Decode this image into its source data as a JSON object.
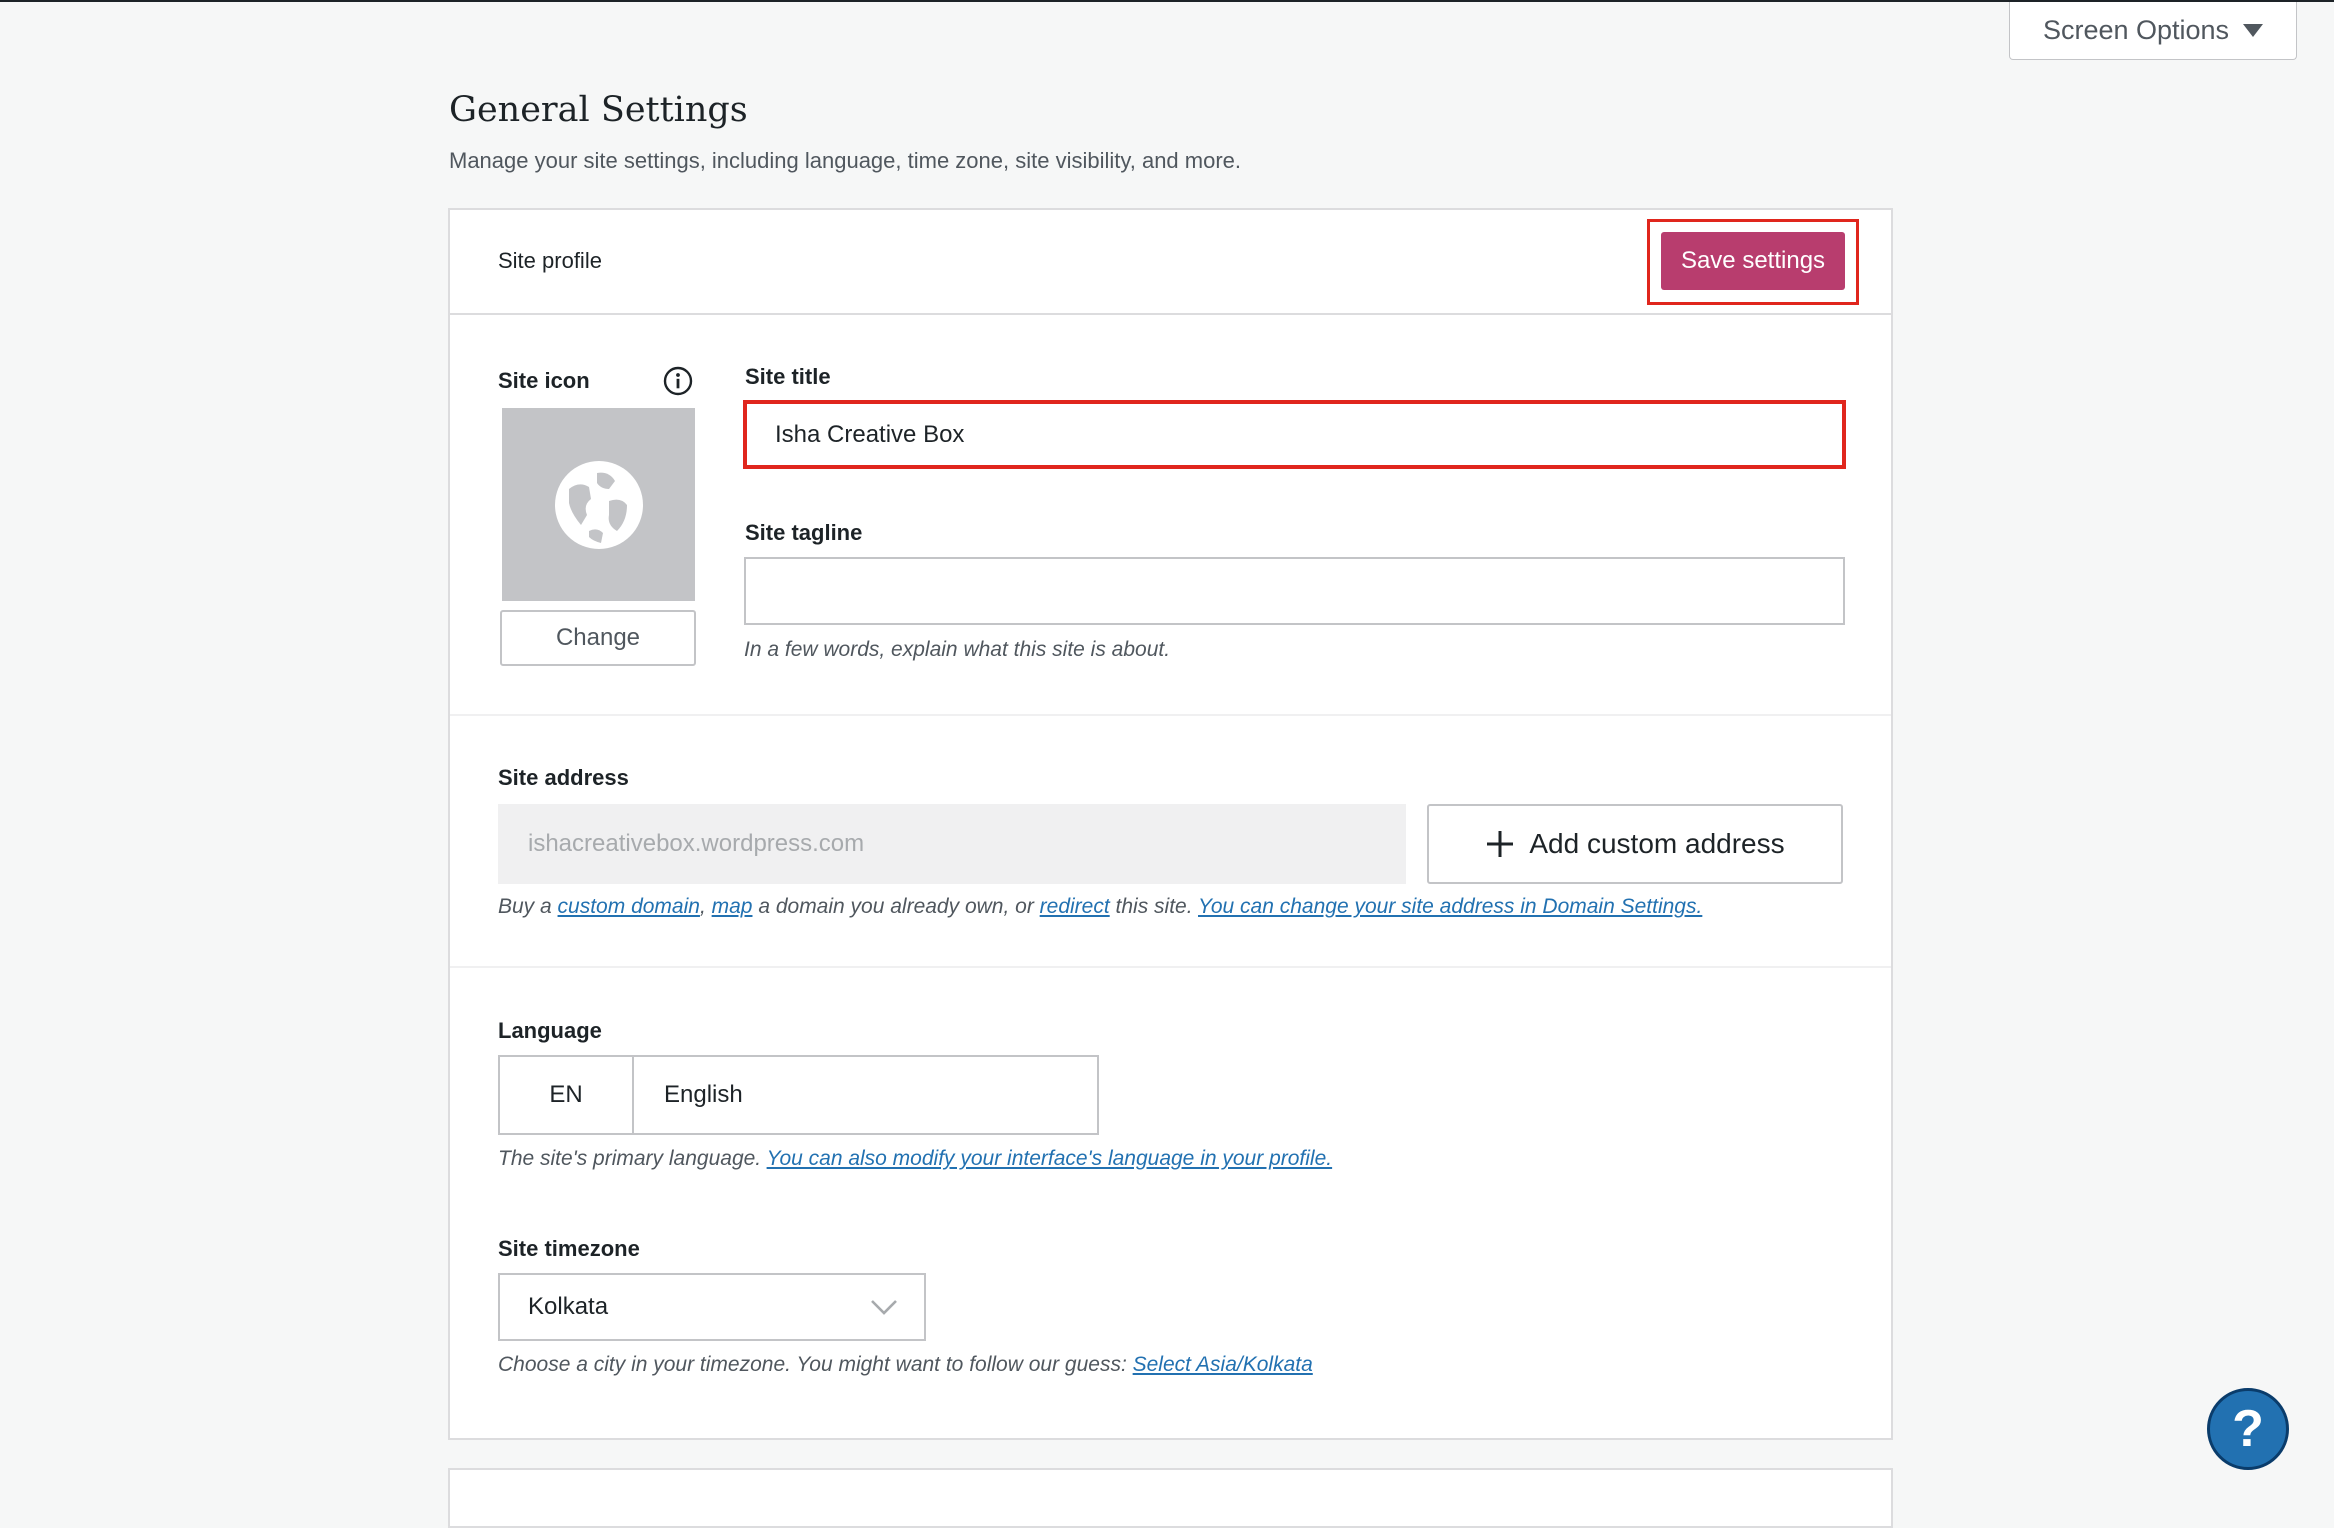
{
  "header": {
    "screen_options_label": "Screen Options"
  },
  "page": {
    "title": "General Settings",
    "subtitle": "Manage your site settings, including language, time zone, site visibility, and more."
  },
  "site_profile": {
    "header_label": "Site profile",
    "save_button_label": "Save settings",
    "site_icon": {
      "label": "Site icon",
      "change_button_label": "Change",
      "icon": "globe-icon"
    },
    "site_title": {
      "label": "Site title",
      "value": "Isha Creative Box"
    },
    "site_tagline": {
      "label": "Site tagline",
      "value": "",
      "help": "In a few words, explain what this site is about."
    },
    "site_address": {
      "label": "Site address",
      "value": "ishacreativebox.wordpress.com",
      "add_button_label": "Add custom address",
      "help": {
        "part1": "Buy a ",
        "link_custom_domain": "custom domain",
        "part2": ", ",
        "link_map": "map",
        "part3": " a domain you already own, or ",
        "link_redirect": "redirect",
        "part4": " this site. ",
        "link_domain_settings": "You can change your site address in Domain Settings."
      }
    },
    "language": {
      "label": "Language",
      "code": "EN",
      "name": "English",
      "help_text": "The site's primary language. ",
      "help_link": "You can also modify your interface's language in your profile."
    },
    "timezone": {
      "label": "Site timezone",
      "value": "Kolkata",
      "help_text": "Choose a city in your timezone. You might want to follow our guess: ",
      "help_link": "Select Asia/Kolkata"
    }
  },
  "help_button": {
    "symbol": "?"
  },
  "colors": {
    "accent": "#b83d6e",
    "highlight": "#e0261d",
    "link": "#2271b1"
  }
}
